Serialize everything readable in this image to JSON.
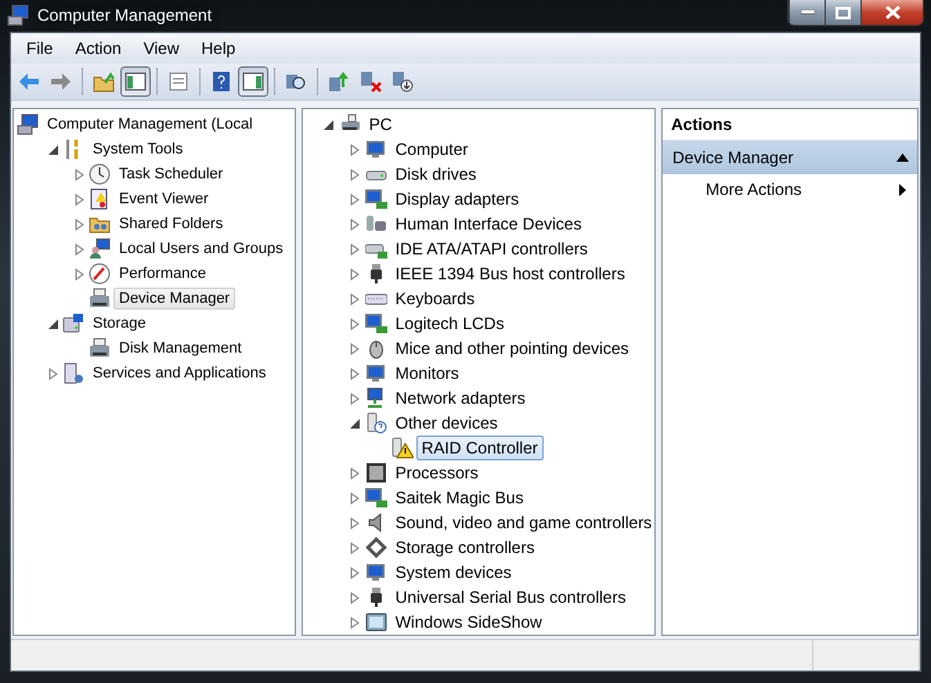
{
  "window": {
    "title": "Computer Management"
  },
  "menu": [
    {
      "label": "File"
    },
    {
      "label": "Action"
    },
    {
      "label": "View"
    },
    {
      "label": "Help"
    }
  ],
  "toolbar": [
    {
      "kind": "button",
      "pressed": false
    },
    {
      "kind": "button",
      "pressed": false
    },
    {
      "kind": "separator"
    },
    {
      "kind": "button",
      "pressed": false
    },
    {
      "kind": "button",
      "pressed": true
    },
    {
      "kind": "separator"
    },
    {
      "kind": "button",
      "pressed": false
    },
    {
      "kind": "separator"
    },
    {
      "kind": "button",
      "pressed": false
    },
    {
      "kind": "button",
      "pressed": true
    },
    {
      "kind": "separator"
    },
    {
      "kind": "button",
      "pressed": false
    },
    {
      "kind": "separator"
    },
    {
      "kind": "button",
      "pressed": false
    },
    {
      "kind": "button",
      "pressed": false
    },
    {
      "kind": "button",
      "pressed": false
    }
  ],
  "console_tree": [
    {
      "label": "Computer Management (Local",
      "selected": false,
      "children": [
        {
          "label": "System Tools",
          "expanded": true,
          "selected": false,
          "children": [
            {
              "label": "Task Scheduler",
              "expanded": false,
              "selected": false
            },
            {
              "label": "Event Viewer",
              "expanded": false,
              "selected": false
            },
            {
              "label": "Shared Folders",
              "expanded": false,
              "selected": false
            },
            {
              "label": "Local Users and Groups",
              "expanded": false,
              "selected": false
            },
            {
              "label": "Performance",
              "expanded": false,
              "selected": false
            },
            {
              "label": "Device Manager",
              "selected": true
            }
          ]
        },
        {
          "label": "Storage",
          "expanded": true,
          "selected": false,
          "children": [
            {
              "label": "Disk Management",
              "selected": false
            }
          ]
        },
        {
          "label": "Services and Applications",
          "expanded": false,
          "selected": false
        }
      ]
    }
  ],
  "device_tree": [
    {
      "label": "PC",
      "expanded": true,
      "selected": false,
      "children": [
        {
          "label": "Computer",
          "expanded": false,
          "selected": false
        },
        {
          "label": "Disk drives",
          "expanded": false,
          "selected": false
        },
        {
          "label": "Display adapters",
          "expanded": false,
          "selected": false
        },
        {
          "label": "Human Interface Devices",
          "expanded": false,
          "selected": false
        },
        {
          "label": "IDE ATA/ATAPI controllers",
          "expanded": false,
          "selected": false
        },
        {
          "label": "IEEE 1394 Bus host controllers",
          "expanded": false,
          "selected": false
        },
        {
          "label": "Keyboards",
          "expanded": false,
          "selected": false
        },
        {
          "label": "Logitech LCDs",
          "expanded": false,
          "selected": false
        },
        {
          "label": "Mice and other pointing devices",
          "expanded": false,
          "selected": false
        },
        {
          "label": "Monitors",
          "expanded": false,
          "selected": false
        },
        {
          "label": "Network adapters",
          "expanded": false,
          "selected": false
        },
        {
          "label": "Other devices",
          "expanded": true,
          "selected": false,
          "children": [
            {
              "label": "RAID Controller",
              "selected": true
            }
          ]
        },
        {
          "label": "Processors",
          "expanded": false,
          "selected": false
        },
        {
          "label": "Saitek Magic Bus",
          "expanded": false,
          "selected": false
        },
        {
          "label": "Sound, video and game controllers",
          "expanded": false,
          "selected": false
        },
        {
          "label": "Storage controllers",
          "expanded": false,
          "selected": false
        },
        {
          "label": "System devices",
          "expanded": false,
          "selected": false
        },
        {
          "label": "Universal Serial Bus controllers",
          "expanded": false,
          "selected": false
        },
        {
          "label": "Windows SideShow",
          "expanded": false,
          "selected": false
        }
      ]
    }
  ],
  "actions": {
    "title": "Actions",
    "sections": [
      {
        "label": "Device Manager",
        "expanded": true,
        "items": [
          {
            "label": "More Actions"
          }
        ]
      }
    ]
  }
}
